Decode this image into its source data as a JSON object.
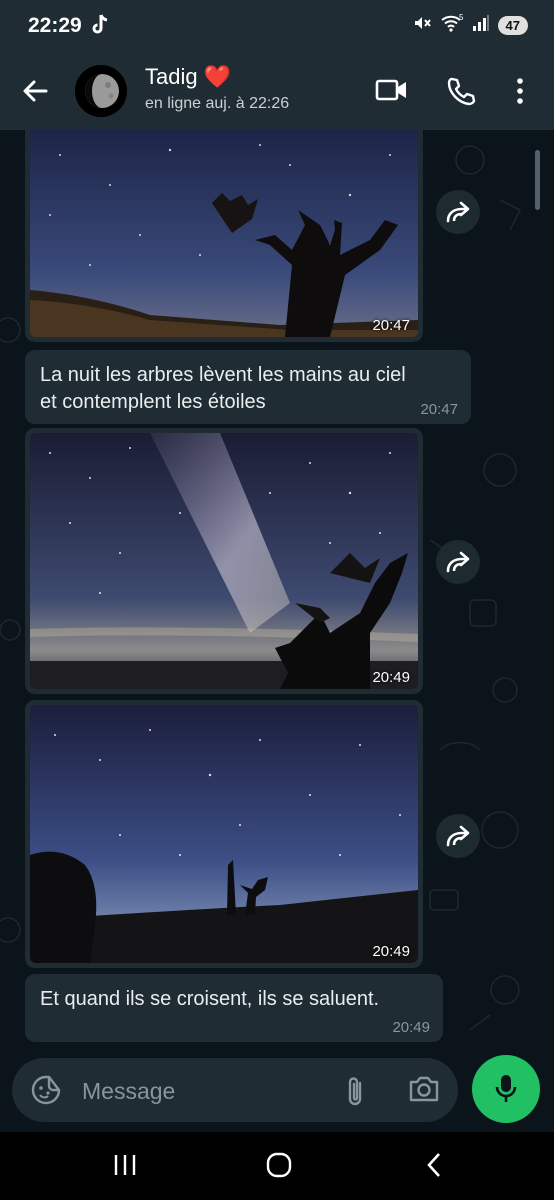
{
  "status_bar": {
    "time": "22:29",
    "battery": "47",
    "wifi_label": "5"
  },
  "header": {
    "contact_name": "Tadig",
    "heart": "❤️",
    "contact_status": "en ligne auj. à 22:26"
  },
  "messages": [
    {
      "type": "image",
      "time": "20:47"
    },
    {
      "type": "text",
      "text": "La nuit les arbres lèvent les mains au ciel et contemplent les étoiles",
      "time": "20:47"
    },
    {
      "type": "image",
      "time": "20:49"
    },
    {
      "type": "image",
      "time": "20:49"
    },
    {
      "type": "text",
      "text": "Et quand ils se croisent, ils se saluent.",
      "time": "20:49"
    }
  ],
  "composer": {
    "placeholder": "Message"
  },
  "icons": {
    "back": "arrow-left-icon",
    "video": "video-camera-icon",
    "call": "phone-icon",
    "more": "more-vertical-icon",
    "forward": "forward-icon",
    "sticker": "sticker-icon",
    "attach": "paperclip-icon",
    "camera": "camera-icon",
    "mic": "microphone-icon",
    "nav_recents": "recents-icon",
    "nav_home": "home-icon",
    "nav_back": "nav-back-icon"
  },
  "colors": {
    "header": "#1f2c33",
    "background": "#0b141a",
    "bubble": "#1f2c33",
    "accent": "#21c063"
  }
}
